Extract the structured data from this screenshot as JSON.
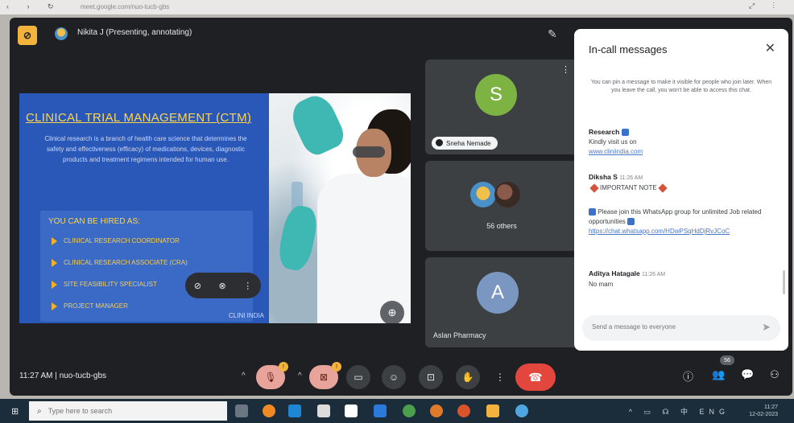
{
  "browser": {
    "nav_glyphs": "‹ › ↻",
    "url": "meet.google.com/nuo-tucb-gbs",
    "right_glyphs": "⤢ ⋮"
  },
  "presenting": {
    "badge": "⊘",
    "presenter_label": "Nikita J (Presenting, annotating)",
    "annotate_icon": "✎"
  },
  "slide": {
    "title": "CLINICAL TRIAL MANAGEMENT (CTM)",
    "body": "Clinical research is a branch of health care science that determines the safety and effectiveness (efficacy) of medications, devices, diagnostic products and treatment regimens intended for human use.",
    "hired_title": "YOU CAN BE HIRED AS:",
    "roles": [
      "Clinical Research Coordinator",
      "Clinical Research Associate (CRA)",
      "Site Feasibility Specialist",
      "Project Manager"
    ],
    "brand": "CLINI INDIA",
    "float_controls": [
      "⊘",
      "⊗",
      "⋮"
    ],
    "zoom_glyph": "⊕"
  },
  "tiles": [
    {
      "initial": "S",
      "name": "Sneha Nemade",
      "menu": "⋮"
    },
    {
      "label": "56 others"
    },
    {
      "initial": "A",
      "name": "Aslan Pharmacy"
    }
  ],
  "messages_panel": {
    "title": "In-call messages",
    "close": "✕",
    "pin_note": "You can pin a message to make it visible for people who join later. When you leave the call, you won't be able to access this chat.",
    "messages": [
      {
        "sender": "Research",
        "time": "",
        "lines": [
          "Kindly visit us on"
        ],
        "link": "www.cliniindia.com"
      },
      {
        "sender": "Diksha S",
        "time": "11:26 AM",
        "lines": [
          "IMPORTANT NOTE"
        ],
        "link": ""
      },
      {
        "sender": "",
        "time": "",
        "lines": [
          "Please join this WhatsApp group for unlimited Job related opportunities"
        ],
        "link": "https://chat.whatsapp.com/HDwPSqHdDjRvJCoC"
      },
      {
        "sender": "Aditya Hatagale",
        "time": "11:26 AM",
        "lines": [
          "No mam"
        ],
        "link": ""
      }
    ],
    "input_placeholder": "Send a message to everyone",
    "send_glyph": "➤"
  },
  "bottom_bar": {
    "time": "11:27 AM",
    "separator": "|",
    "meeting_code": "nuo-tucb-gbs",
    "mic_glyph": "🎙",
    "mic_badge": "!",
    "cam_glyph": "⊠",
    "cam_badge": "!",
    "captions_glyph": "▭",
    "emoji_glyph": "☺",
    "present_glyph": "⊡",
    "hand_glyph": "✋",
    "more_glyph": "⋮",
    "end_glyph": "☎",
    "info_glyph": "ⓘ",
    "people_glyph": "👥",
    "chat_glyph": "💬",
    "activities_glyph": "⚇",
    "chat_count": "56",
    "caret": "^"
  },
  "taskbar": {
    "start_glyph": "⊞",
    "search_placeholder": "Type here to search",
    "search_glyph": "⌕",
    "tray_glyphs": "^ ▭ ☊ 中 ENG",
    "tray_time": "11:27",
    "tray_date": "12-02-2023",
    "app_colors": [
      "#6b7683",
      "#f08a24",
      "#1f86d6",
      "#dcdcdc",
      "#ffffff",
      "#2b79d8",
      "#4aa04a",
      "#e07a2b",
      "#d9532b",
      "#f2b33d",
      "#4ea7e0"
    ]
  },
  "colors": {
    "meet_bg": "#1f2023",
    "tile_bg": "#3c4043",
    "slide_blue": "#2a58b8",
    "slide_yellow": "#ffd54a",
    "end_call_red": "#e3463c",
    "present_badge": "#f2b33d"
  }
}
